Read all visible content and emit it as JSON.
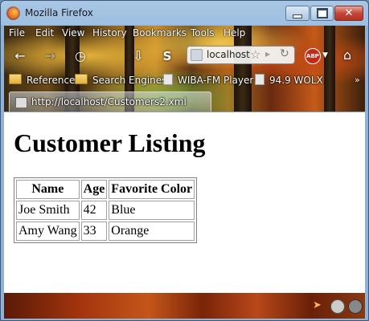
{
  "window": {
    "title": "Mozilla Firefox"
  },
  "menu": [
    "File",
    "Edit",
    "View",
    "History",
    "Bookmarks",
    "Tools",
    "Help"
  ],
  "navbar": {
    "url": "localhost",
    "addon_badge": "ABP"
  },
  "bookmarks": [
    "Reference",
    "Search Engines",
    "WIBA-FM Player",
    "94.9 WOLX"
  ],
  "tab": {
    "title": "http://localhost/Customers2.xml"
  },
  "page": {
    "heading": "Customer Listing",
    "table": {
      "headers": [
        "Name",
        "Age",
        "Favorite Color"
      ],
      "rows": [
        [
          "Joe Smith",
          "42",
          "Blue"
        ],
        [
          "Amy Wang",
          "33",
          "Orange"
        ]
      ]
    }
  },
  "icons": {
    "back": "back-arrow-icon",
    "forward": "forward-arrow-icon",
    "history": "clock-icon",
    "downloads": "download-icon",
    "skype": "skype-icon",
    "bookmark": "star-icon",
    "reload": "reload-icon",
    "home": "home-icon"
  }
}
